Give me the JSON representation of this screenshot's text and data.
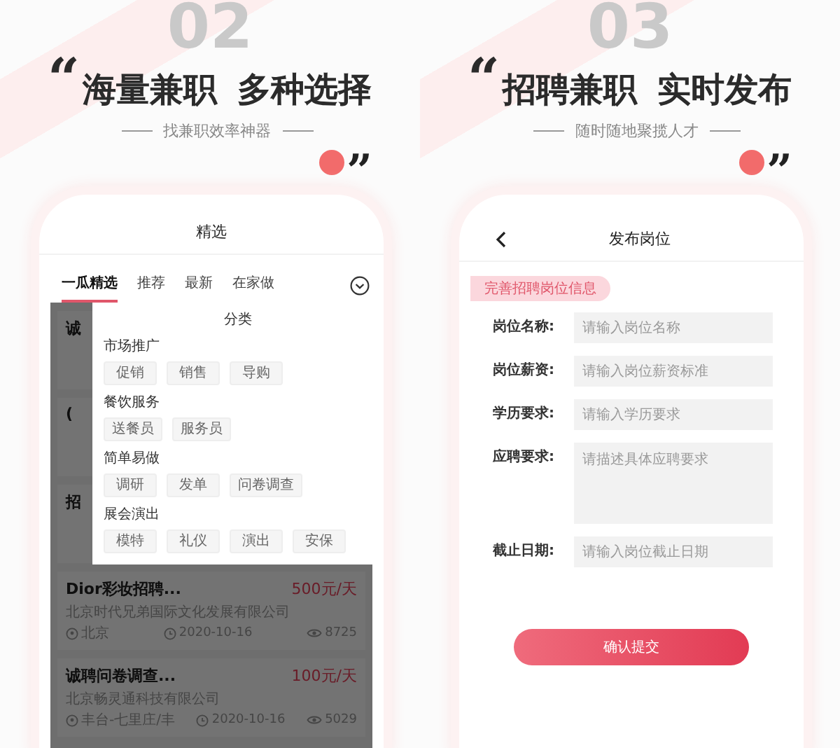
{
  "panels": [
    {
      "number": "02",
      "open_quote": "“",
      "headline": "海量兼职 多种选择",
      "subtitle": "找兼职效率神器",
      "close_quote": "”",
      "screen": {
        "kind": "job_list",
        "title": "精选",
        "tabs": [
          {
            "label": "一瓜精选",
            "selected": true
          },
          {
            "label": "推荐",
            "selected": false
          },
          {
            "label": "最新",
            "selected": false
          },
          {
            "label": "在家做",
            "selected": false
          }
        ],
        "jobs": [
          {
            "title": "诚"
          },
          {
            "title": "("
          },
          {
            "title": "招"
          },
          {
            "title": "Dior彩妆招聘...",
            "pay": "500元/天",
            "company": "北京时代兄弟国际文化发展有限公司",
            "location": "北京",
            "date": "2020-10-16",
            "views": "8725"
          },
          {
            "title": "诚聘问卷调查...",
            "pay": "100元/天",
            "company": "北京畅灵通科技有限公司",
            "location": "丰台-七里庄/丰",
            "date": "2020-10-16",
            "views": "5029"
          }
        ],
        "dropdown": {
          "title": "分类",
          "groups": [
            {
              "name": "市场推广",
              "tags": [
                "促销",
                "销售",
                "导购"
              ]
            },
            {
              "name": "餐饮服务",
              "tags": [
                "送餐员",
                "服务员"
              ]
            },
            {
              "name": "简单易做",
              "tags": [
                "调研",
                "发单",
                "问卷调查"
              ]
            },
            {
              "name": "展会演出",
              "tags": [
                "模特",
                "礼仪",
                "演出",
                "安保"
              ]
            }
          ]
        }
      }
    },
    {
      "number": "03",
      "open_quote": "“",
      "headline": "招聘兼职 实时发布",
      "subtitle": "随时随地聚揽人才",
      "close_quote": "”",
      "screen": {
        "kind": "post_form",
        "title": "发布岗位",
        "section": "完善招聘岗位信息",
        "fields": [
          {
            "kind": "line",
            "label": "岗位名称:",
            "placeholder": "请输入岗位名称"
          },
          {
            "kind": "line",
            "label": "岗位薪资:",
            "placeholder": "请输入岗位薪资标准"
          },
          {
            "kind": "line",
            "label": "学历要求:",
            "placeholder": "请输入学历要求"
          },
          {
            "kind": "area",
            "label": "应聘要求:",
            "placeholder": "请描述具体应聘要求"
          },
          {
            "kind": "line",
            "label": "截止日期:",
            "placeholder": "请输入岗位截止日期"
          }
        ],
        "submit": "确认提交"
      }
    }
  ]
}
